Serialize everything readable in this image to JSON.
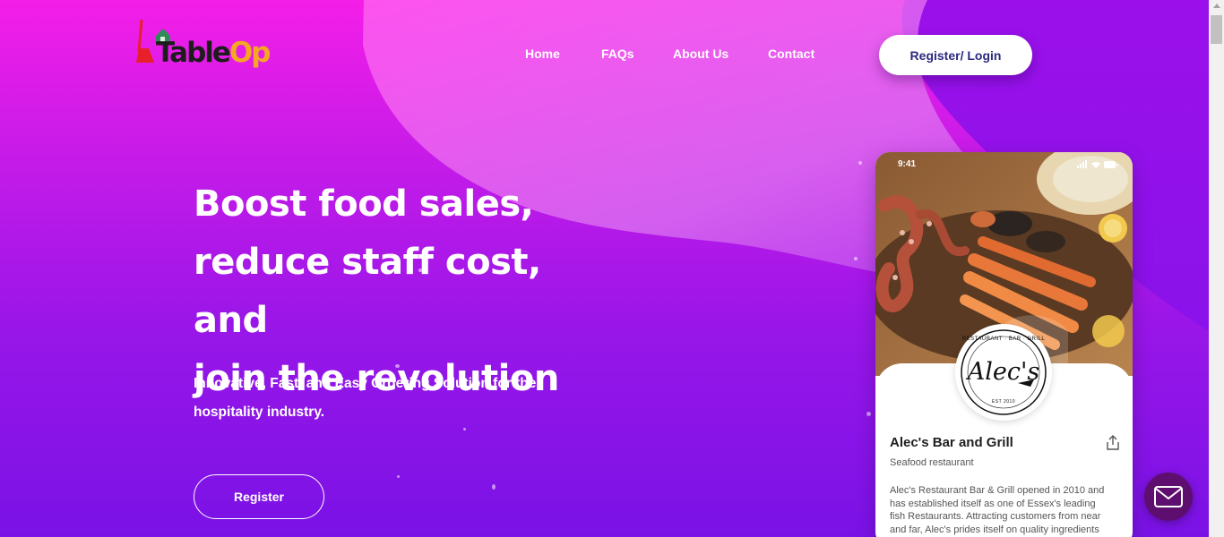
{
  "brand": {
    "logo_text_table": "Table",
    "logo_text_op": "Op",
    "colors": {
      "logo_dark": "#1c1c1c",
      "logo_accent": "#f5a623",
      "logo_broom": "#e8202a",
      "logo_house": "#2e8b57"
    }
  },
  "nav": {
    "items": [
      {
        "label": "Home"
      },
      {
        "label": "FAQs"
      },
      {
        "label": "About Us"
      },
      {
        "label": "Contact"
      }
    ],
    "login_label": "Register/ Login"
  },
  "hero": {
    "title_lines": [
      "Boost food sales,",
      "reduce staff cost, and",
      "join the revolution"
    ],
    "subtitle_lines": [
      "Innovative, Fast, and Easy Ordering Solution for the",
      "hospitality industry."
    ],
    "register_label": "Register"
  },
  "phone": {
    "status_time": "9:41",
    "logo_top_text": "RESTAURANT · BAR · GRILL",
    "logo_name": "Alec's",
    "logo_est": "EST 2010",
    "restaurant_name": "Alec's Bar and Grill",
    "restaurant_type": "Seafood restaurant",
    "description_lines": [
      "Alec's Restaurant Bar & Grill opened in 2010 and",
      "has established itself as one of Essex's leading",
      "fish Restaurants. Attracting customers from near",
      "and far, Alec's prides itself on quality ingredients"
    ]
  },
  "chat": {
    "icon": "mail-icon",
    "color": "#5e0e6e"
  },
  "theme": {
    "gradient_top": "#f41ee8",
    "gradient_bottom": "#7a12e6",
    "button_text": "#2c2a80"
  }
}
